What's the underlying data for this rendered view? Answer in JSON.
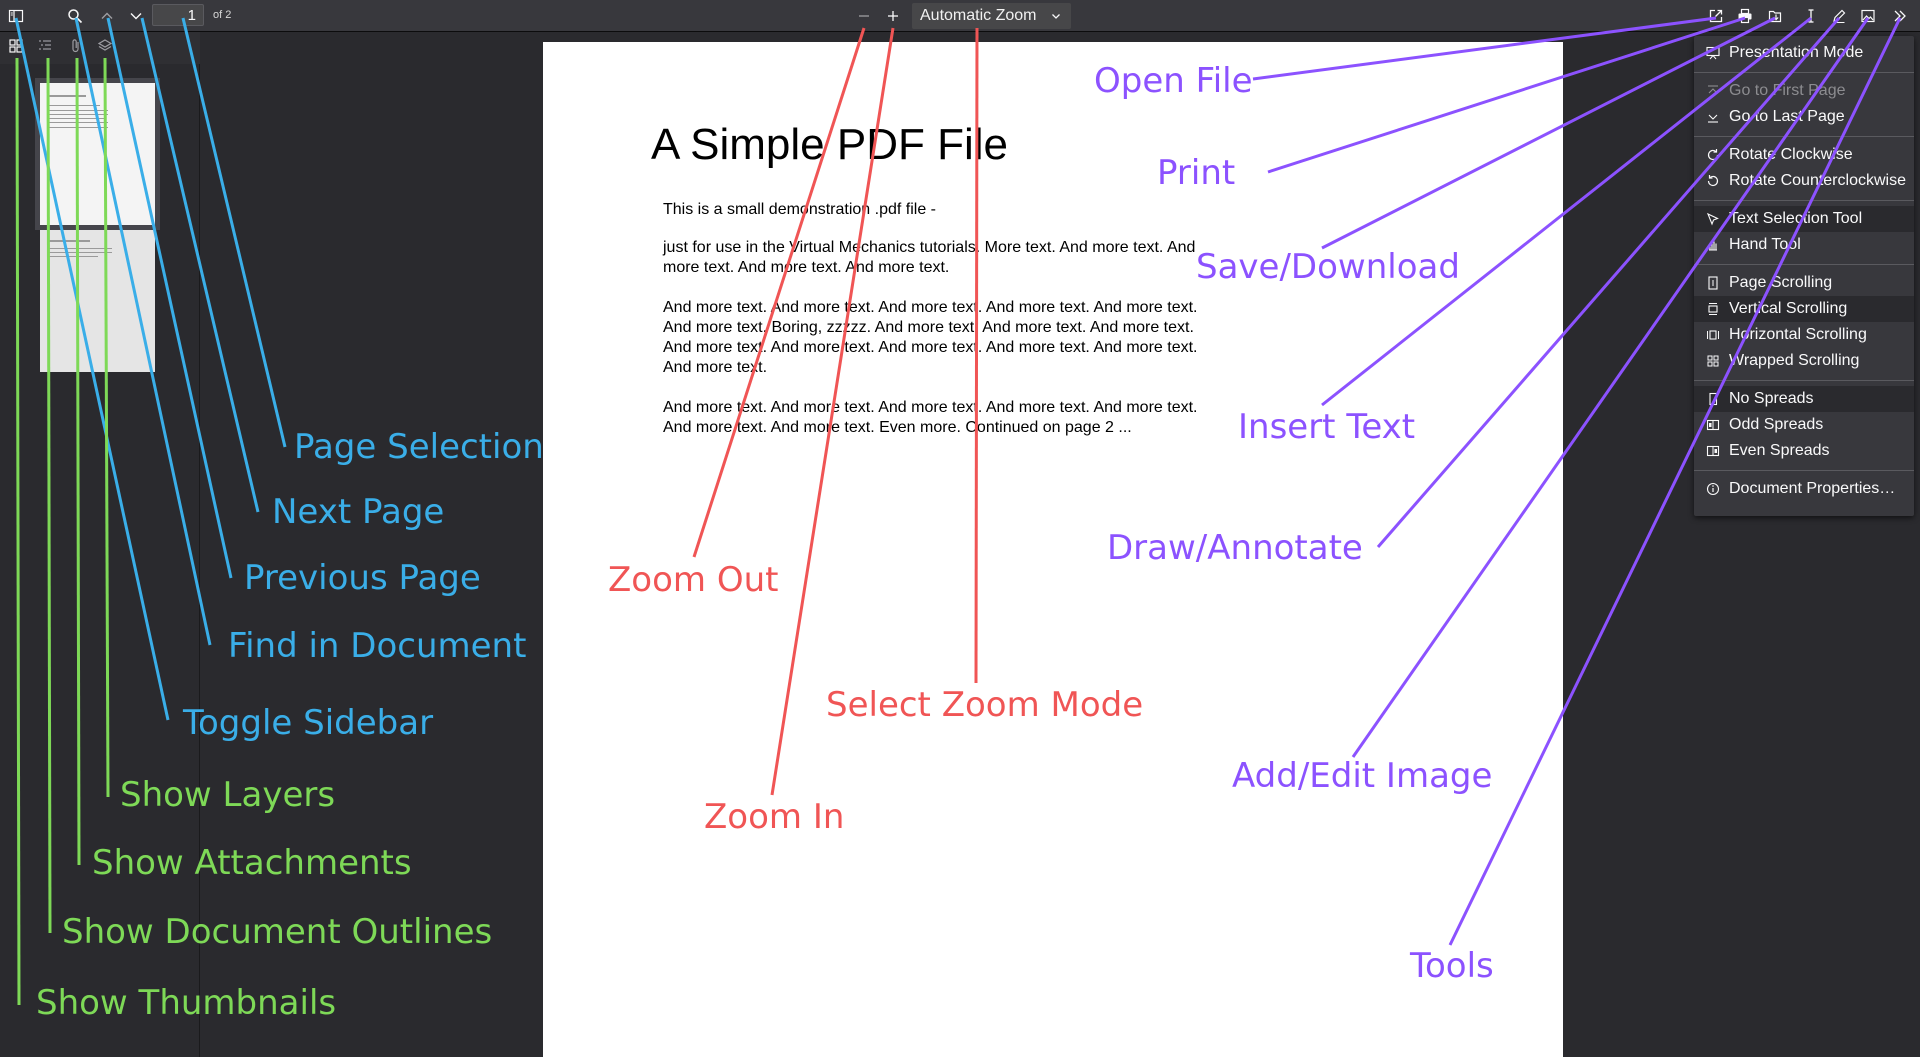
{
  "toolbar": {
    "page_number": "1",
    "page_count": "of 2",
    "zoom_value": "Automatic Zoom",
    "icons": {
      "toggle_sidebar": "sidebar-icon",
      "find": "search-icon",
      "previous": "chevron-up-icon",
      "next": "chevron-down-icon",
      "zoom_out": "minus-icon",
      "zoom_in": "plus-icon",
      "open_file": "open-file-icon",
      "print": "printer-icon",
      "save": "download-icon",
      "text": "text-cursor-icon",
      "draw": "pencil-icon",
      "image": "image-icon",
      "tools": "double-chevron-right-icon"
    }
  },
  "sidebar_toolbar": {
    "icons": [
      "thumbnails-icon",
      "outline-icon",
      "attachment-icon",
      "layers-icon"
    ]
  },
  "document": {
    "title": "A Simple PDF File",
    "paragraphs": [
      "This is a small demonstration .pdf file -",
      "just for use in the Virtual Mechanics tutorials. More text. And more text. And more text. And more text. And more text.",
      "And more text. And more text. And more text. And more text. And more text. And more text. Boring, zzzzz. And more text. And more text. And more text. And more text. And more text. And more text. And more text. And more text. And more text.",
      "And more text. And more text. And more text. And more text. And more text. And more text. And more text. Even more. Continued on page 2 ..."
    ]
  },
  "menu": {
    "items": [
      "Presentation Mode",
      "Go to First Page",
      "Go to Last Page",
      "Rotate Clockwise",
      "Rotate Counterclockwise",
      "Text Selection Tool",
      "Hand Tool",
      "Page Scrolling",
      "Vertical Scrolling",
      "Horizontal Scrolling",
      "Wrapped Scrolling",
      "No Spreads",
      "Odd Spreads",
      "Even Spreads",
      "Document Properties…"
    ]
  },
  "annotations": {
    "blue": [
      "Page Selection",
      "Next Page",
      "Previous Page",
      "Find in Document",
      "Toggle Sidebar"
    ],
    "green": [
      "Show Layers",
      "Show Attachments",
      "Show Document Outlines",
      "Show Thumbnails"
    ],
    "red": [
      "Zoom Out",
      "Select Zoom Mode",
      "Zoom In"
    ],
    "purple": [
      "Open File",
      "Print",
      "Save/Download",
      "Insert Text",
      "Draw/Annotate",
      "Add/Edit Image",
      "Tools"
    ]
  },
  "colors": {
    "blue": "#3aaee8",
    "green": "#7ed957",
    "red": "#f05555",
    "purple": "#8c52ff"
  }
}
